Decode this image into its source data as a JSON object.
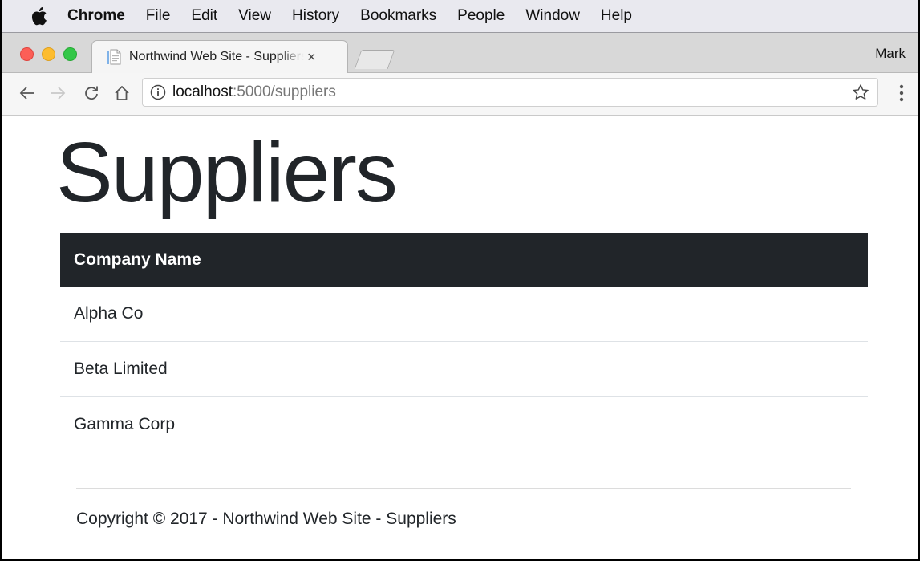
{
  "menubar": {
    "app": "Chrome",
    "items": [
      "File",
      "Edit",
      "View",
      "History",
      "Bookmarks",
      "People",
      "Window",
      "Help"
    ]
  },
  "browser": {
    "tab_title": "Northwind Web Site - Suppliers",
    "tab_close": "×",
    "profile": "Mark",
    "url_host": "localhost",
    "url_rest": ":5000/suppliers"
  },
  "page": {
    "title": "Suppliers",
    "table": {
      "header": "Company Name",
      "rows": [
        "Alpha Co",
        "Beta Limited",
        "Gamma Corp"
      ]
    },
    "footer": "Copyright © 2017 - Northwind Web Site - Suppliers"
  },
  "colors": {
    "table_header_bg": "#212529",
    "page_text": "#212529"
  }
}
